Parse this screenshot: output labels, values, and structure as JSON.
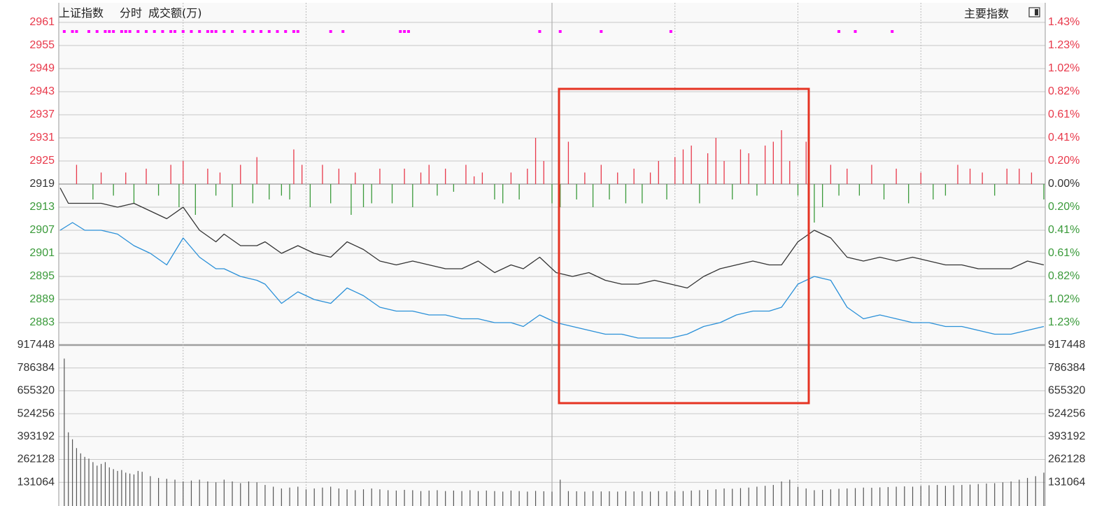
{
  "header": {
    "index_name": "上证指数",
    "mode": "分时",
    "volume_label": "成交额(万)",
    "indicator_button": "主要指数"
  },
  "colors": {
    "up": "#e8384a",
    "down": "#3a9a3a",
    "line_black": "#333333",
    "line_blue": "#2a90d8",
    "signal": "#ff00ff",
    "highlight": "#e53322",
    "grid": "#c8c8c8",
    "volume_bar": "#555555"
  },
  "chart_data": [
    {
      "type": "line",
      "title": "",
      "y_left_ticks_up": [
        "2961",
        "2955",
        "2949",
        "2943",
        "2937",
        "2931",
        "2925"
      ],
      "y_left_base": "2919",
      "y_left_ticks_down": [
        "2913",
        "2907",
        "2901",
        "2895",
        "2889",
        "2883"
      ],
      "y_right_ticks_up": [
        "1.43%",
        "1.23%",
        "1.02%",
        "0.82%",
        "0.61%",
        "0.41%",
        "0.20%"
      ],
      "y_right_base": "0.00%",
      "y_right_ticks_down": [
        "0.20%",
        "0.41%",
        "0.61%",
        "0.82%",
        "1.02%",
        "1.23%"
      ],
      "ylim": [
        2880,
        2964
      ],
      "xlim": [
        0,
        240
      ],
      "series": [
        {
          "color": "#333333",
          "x": [
            0,
            2,
            6,
            10,
            14,
            18,
            22,
            26,
            30,
            34,
            38,
            40,
            44,
            48,
            50,
            54,
            58,
            62,
            66,
            70,
            74,
            78,
            82,
            86,
            90,
            94,
            98,
            102,
            106,
            110,
            113,
            117,
            121,
            125,
            129,
            133,
            137,
            141,
            145,
            149,
            153,
            157,
            161,
            165,
            169,
            173,
            176,
            180,
            184,
            188,
            192,
            196,
            200,
            204,
            208,
            212,
            216,
            220,
            224,
            228,
            232,
            236,
            240
          ],
          "y": [
            2918,
            2914,
            2914,
            2914,
            2913,
            2914,
            2912,
            2910,
            2913,
            2907,
            2904,
            2906,
            2903,
            2903,
            2904,
            2901,
            2903,
            2901,
            2900,
            2904,
            2902,
            2899,
            2898,
            2899,
            2898,
            2897,
            2897,
            2899,
            2896,
            2898,
            2897,
            2900,
            2896,
            2895,
            2896,
            2894,
            2893,
            2893,
            2894,
            2893,
            2892,
            2895,
            2897,
            2898,
            2899,
            2898,
            2898,
            2904,
            2907,
            2905,
            2900,
            2899,
            2900,
            2899,
            2900,
            2899,
            2898,
            2898,
            2897,
            2897,
            2897,
            2899,
            2898
          ]
        },
        {
          "color": "#2a90d8",
          "x": [
            0,
            3,
            6,
            10,
            14,
            18,
            22,
            26,
            30,
            34,
            38,
            40,
            44,
            48,
            50,
            54,
            58,
            62,
            66,
            70,
            74,
            78,
            82,
            86,
            90,
            94,
            98,
            102,
            106,
            110,
            113,
            117,
            121,
            125,
            129,
            133,
            137,
            141,
            145,
            149,
            153,
            157,
            161,
            165,
            169,
            173,
            176,
            180,
            184,
            188,
            192,
            196,
            200,
            204,
            208,
            212,
            216,
            220,
            224,
            228,
            232,
            236,
            240
          ],
          "y": [
            2907,
            2909,
            2907,
            2907,
            2906,
            2903,
            2901,
            2898,
            2905,
            2900,
            2897,
            2897,
            2895,
            2894,
            2893,
            2888,
            2891,
            2889,
            2888,
            2892,
            2890,
            2887,
            2886,
            2886,
            2885,
            2885,
            2884,
            2884,
            2883,
            2883,
            2882,
            2885,
            2883,
            2882,
            2881,
            2880,
            2880,
            2879,
            2879,
            2879,
            2880,
            2882,
            2883,
            2885,
            2886,
            2886,
            2887,
            2893,
            2895,
            2894,
            2887,
            2884,
            2885,
            2884,
            2883,
            2883,
            2882,
            2882,
            2881,
            2880,
            2880,
            2881,
            2882
          ]
        }
      ],
      "annotation": "red rectangle highlighting x 122 to 183"
    },
    {
      "type": "bar",
      "title": "",
      "description": "market breadth bars around baseline 2919, red above / green below",
      "x": [
        4,
        8,
        10,
        13,
        16,
        18,
        21,
        24,
        27,
        29,
        30,
        33,
        36,
        38,
        39,
        42,
        44,
        47,
        48,
        51,
        54,
        56,
        57,
        59,
        61,
        64,
        66,
        68,
        71,
        72,
        74,
        76,
        78,
        81,
        84,
        86,
        88,
        90,
        92,
        94,
        96,
        99,
        101,
        103,
        106,
        108,
        110,
        112,
        114,
        116,
        118,
        120,
        122,
        124,
        126,
        128,
        130,
        132,
        134,
        136,
        138,
        140,
        142,
        144,
        146,
        148,
        150,
        152,
        154,
        156,
        158,
        160,
        162,
        164,
        166,
        168,
        170,
        172,
        174,
        176,
        178,
        180,
        182,
        184,
        186,
        188,
        190,
        192,
        195,
        198,
        201,
        204,
        207,
        210,
        213,
        216,
        219,
        222,
        225,
        228,
        231,
        234,
        237,
        240
      ],
      "values": [
        5,
        -4,
        3,
        -3,
        3,
        -5,
        4,
        -3,
        5,
        -6,
        6,
        -8,
        4,
        -3,
        3,
        -6,
        5,
        -5,
        7,
        -4,
        -3,
        -4,
        9,
        5,
        -6,
        5,
        -5,
        4,
        -8,
        3,
        -6,
        -5,
        4,
        -5,
        4,
        -6,
        3,
        5,
        -3,
        4,
        -2,
        5,
        2,
        3,
        -4,
        -5,
        3,
        -4,
        4,
        12,
        6,
        -5,
        -6,
        11,
        -4,
        3,
        -6,
        5,
        -4,
        3,
        -5,
        4,
        -5,
        3,
        6,
        -4,
        7,
        9,
        10,
        -5,
        8,
        12,
        6,
        -4,
        9,
        8,
        -3,
        10,
        11,
        14,
        6,
        -3,
        11,
        -10,
        -6,
        5,
        -3,
        4,
        -3,
        5,
        -4,
        4,
        -5,
        3,
        -4,
        -3,
        5,
        4,
        3,
        -3,
        4,
        4,
        3,
        -4
      ]
    },
    {
      "type": "scatter",
      "title": "",
      "description": "magenta signal dots in top row",
      "x": [
        1,
        3,
        4,
        7,
        9,
        11,
        12,
        13,
        15,
        16,
        17,
        19,
        21,
        23,
        25,
        27,
        28,
        30,
        32,
        34,
        36,
        37,
        38,
        40,
        42,
        45,
        47,
        49,
        51,
        53,
        55,
        57,
        58,
        66,
        69,
        83,
        84,
        85,
        117,
        122,
        132,
        149,
        190,
        194,
        203
      ],
      "values": [
        1,
        1,
        1,
        1,
        1,
        1,
        1,
        1,
        1,
        1,
        1,
        1,
        1,
        1,
        1,
        1,
        1,
        1,
        1,
        1,
        1,
        1,
        1,
        1,
        1,
        1,
        1,
        1,
        1,
        1,
        1,
        1,
        1,
        1,
        1,
        1,
        1,
        1,
        1,
        1,
        1,
        1,
        1,
        1,
        1
      ]
    },
    {
      "type": "bar",
      "title": "",
      "ylabel": "成交额(万)",
      "y_ticks": [
        "917448",
        "786384",
        "655320",
        "524256",
        "393192",
        "262128",
        "131064"
      ],
      "ylim": [
        0,
        917448
      ],
      "x": [
        1,
        2,
        3,
        4,
        5,
        6,
        7,
        8,
        9,
        10,
        11,
        12,
        13,
        14,
        15,
        16,
        17,
        18,
        19,
        20,
        22,
        24,
        26,
        28,
        30,
        32,
        34,
        36,
        38,
        40,
        42,
        44,
        46,
        48,
        50,
        52,
        54,
        56,
        58,
        60,
        62,
        64,
        66,
        68,
        70,
        72,
        74,
        76,
        78,
        80,
        82,
        84,
        86,
        88,
        90,
        92,
        94,
        96,
        98,
        100,
        102,
        104,
        106,
        108,
        110,
        112,
        114,
        116,
        118,
        120,
        122,
        124,
        126,
        128,
        130,
        132,
        134,
        136,
        138,
        140,
        142,
        144,
        146,
        148,
        150,
        152,
        154,
        156,
        158,
        160,
        162,
        164,
        166,
        168,
        170,
        172,
        174,
        176,
        178,
        180,
        182,
        184,
        186,
        188,
        190,
        192,
        194,
        196,
        198,
        200,
        202,
        204,
        206,
        208,
        210,
        212,
        214,
        216,
        218,
        220,
        222,
        224,
        226,
        228,
        230,
        232,
        234,
        236,
        238,
        240
      ],
      "values": [
        840000,
        420000,
        380000,
        330000,
        300000,
        280000,
        270000,
        250000,
        230000,
        240000,
        250000,
        220000,
        210000,
        200000,
        205000,
        190000,
        185000,
        180000,
        200000,
        195000,
        170000,
        160000,
        155000,
        150000,
        140000,
        145000,
        150000,
        140000,
        135000,
        150000,
        140000,
        130000,
        140000,
        135000,
        120000,
        110000,
        100000,
        105000,
        110000,
        95000,
        100000,
        105000,
        110000,
        100000,
        95000,
        90000,
        95000,
        100000,
        95000,
        90000,
        88000,
        92000,
        90000,
        85000,
        88000,
        90000,
        85000,
        88000,
        85000,
        90000,
        85000,
        88000,
        85000,
        82000,
        88000,
        85000,
        82000,
        86000,
        84000,
        82000,
        150000,
        85000,
        84000,
        82000,
        85000,
        83000,
        84000,
        82000,
        85000,
        83000,
        84000,
        82000,
        85000,
        83000,
        84000,
        85000,
        88000,
        90000,
        92000,
        95000,
        100000,
        98000,
        102000,
        105000,
        110000,
        115000,
        120000,
        140000,
        150000,
        110000,
        100000,
        90000,
        92000,
        95000,
        98000,
        100000,
        102000,
        105000,
        104000,
        106000,
        108000,
        110000,
        112000,
        110000,
        115000,
        118000,
        120000,
        115000,
        118000,
        120000,
        122000,
        125000,
        128000,
        130000,
        135000,
        140000,
        150000,
        160000,
        170000,
        190000
      ]
    }
  ]
}
